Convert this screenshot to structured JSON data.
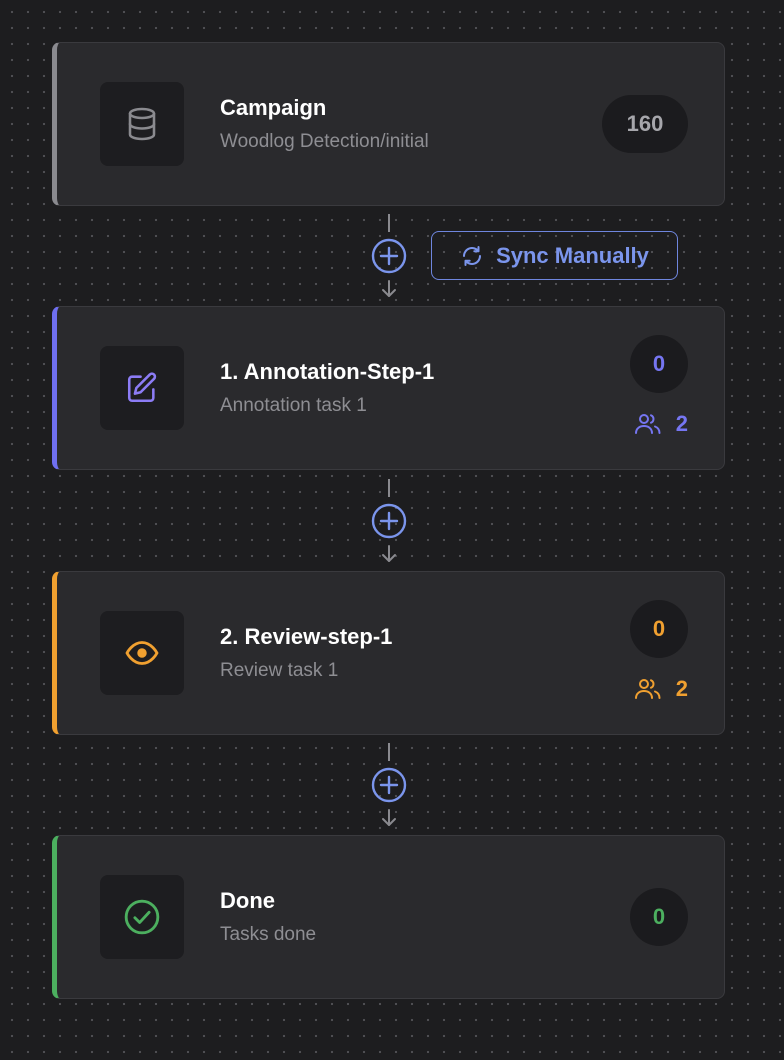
{
  "colors": {
    "neutral": "#8a8a8f",
    "annotation": "#6f6ff0",
    "review": "#f0a030",
    "done": "#4caf5f",
    "accent": "#7b95ec"
  },
  "steps": [
    {
      "title": "Campaign",
      "subtitle": "Woodlog Detection/initial",
      "count": "160",
      "icon": "database-icon"
    },
    {
      "title": "1. Annotation-Step-1",
      "subtitle": "Annotation task 1",
      "count": "0",
      "users": "2",
      "icon": "edit-icon"
    },
    {
      "title": "2. Review-step-1",
      "subtitle": "Review task 1",
      "count": "0",
      "users": "2",
      "icon": "eye-icon"
    },
    {
      "title": "Done",
      "subtitle": "Tasks done",
      "count": "0",
      "icon": "check-circle-icon"
    }
  ],
  "sync_button": {
    "label": "Sync Manually",
    "icon": "refresh-icon"
  }
}
